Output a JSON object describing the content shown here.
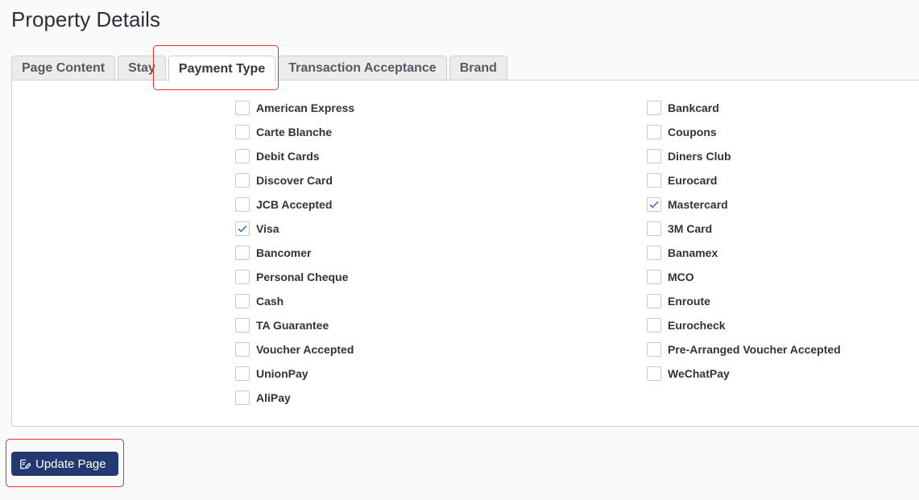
{
  "page": {
    "title": "Property Details"
  },
  "tabs": [
    {
      "label": "Page Content",
      "active": false
    },
    {
      "label": "Stay",
      "active": false
    },
    {
      "label": "Payment Type",
      "active": true
    },
    {
      "label": "Transaction Acceptance",
      "active": false
    },
    {
      "label": "Brand",
      "active": false
    }
  ],
  "payment_types": {
    "left": [
      {
        "label": "American Express",
        "checked": false
      },
      {
        "label": "Carte Blanche",
        "checked": false
      },
      {
        "label": "Debit Cards",
        "checked": false
      },
      {
        "label": "Discover Card",
        "checked": false
      },
      {
        "label": "JCB Accepted",
        "checked": false
      },
      {
        "label": "Visa",
        "checked": true
      },
      {
        "label": "Bancomer",
        "checked": false
      },
      {
        "label": "Personal Cheque",
        "checked": false
      },
      {
        "label": "Cash",
        "checked": false
      },
      {
        "label": "TA Guarantee",
        "checked": false
      },
      {
        "label": "Voucher Accepted",
        "checked": false
      },
      {
        "label": "UnionPay",
        "checked": false
      },
      {
        "label": "AliPay",
        "checked": false
      }
    ],
    "right": [
      {
        "label": "Bankcard",
        "checked": false
      },
      {
        "label": "Coupons",
        "checked": false
      },
      {
        "label": "Diners Club",
        "checked": false
      },
      {
        "label": "Eurocard",
        "checked": false
      },
      {
        "label": "Mastercard",
        "checked": true
      },
      {
        "label": "3M Card",
        "checked": false
      },
      {
        "label": "Banamex",
        "checked": false
      },
      {
        "label": "MCO",
        "checked": false
      },
      {
        "label": "Enroute",
        "checked": false
      },
      {
        "label": "Eurocheck",
        "checked": false
      },
      {
        "label": "Pre-Arranged Voucher Accepted",
        "checked": false
      },
      {
        "label": "WeChatPay",
        "checked": false
      }
    ]
  },
  "actions": {
    "update_label": "Update Page",
    "update_icon": "edit-icon"
  },
  "colors": {
    "accent": "#223a6f",
    "highlight": "#e33232",
    "check": "#3a6fb5"
  }
}
